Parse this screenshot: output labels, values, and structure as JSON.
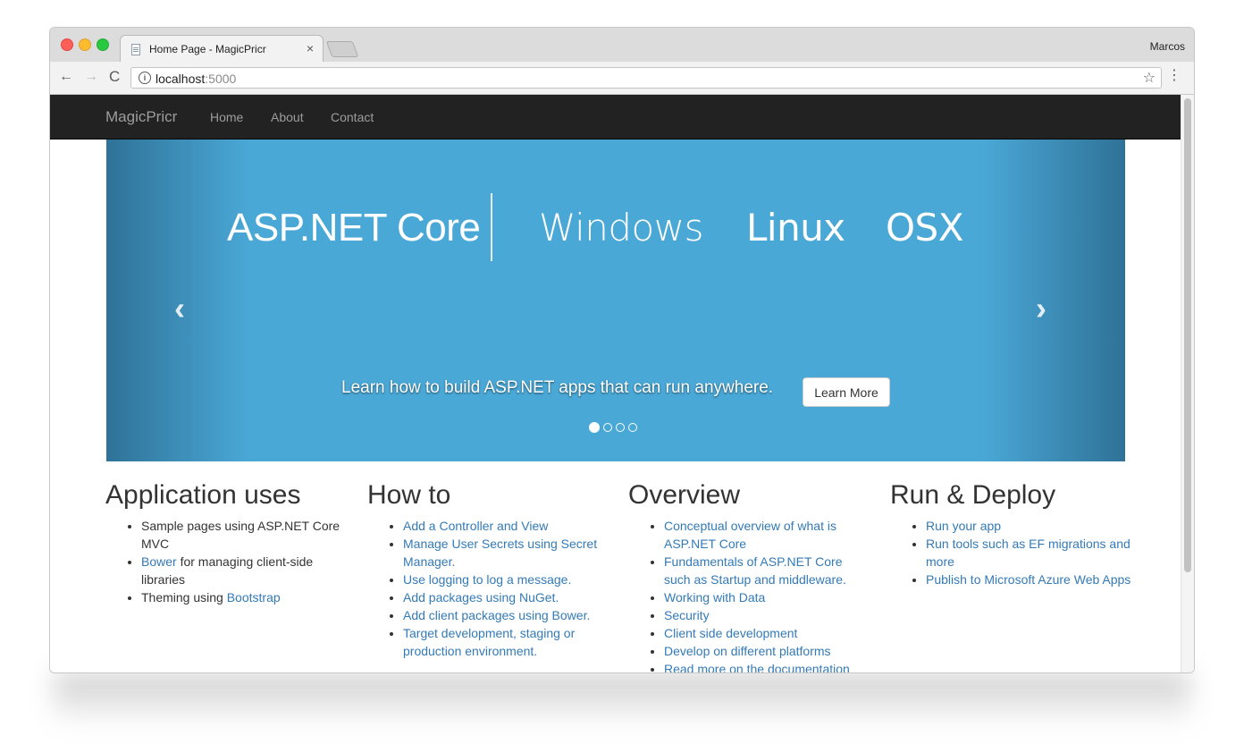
{
  "browser": {
    "tab_title": "Home Page - MagicPricr",
    "tab_close": "×",
    "profile_name": "Marcos",
    "url_host": "localhost",
    "url_port": ":5000",
    "info_glyph": "i",
    "back_glyph": "←",
    "forward_glyph": "→",
    "reload_glyph": "C",
    "star_glyph": "☆",
    "menu_glyph": "⋮",
    "icons": {
      "back": "back-arrow-icon",
      "forward": "forward-arrow-icon",
      "reload": "reload-icon",
      "info": "info-circle-icon",
      "bookmark": "star-icon",
      "menu": "vertical-dots-icon",
      "favicon": "page-icon"
    }
  },
  "navbar": {
    "brand": "MagicPricr",
    "links": [
      "Home",
      "About",
      "Contact"
    ],
    "background": "#222222",
    "link_color": "#9d9d9d"
  },
  "carousel": {
    "words": {
      "aspnet": "ASP.NET Core",
      "windows": "Windows",
      "linux": "Linux",
      "osx": "OSX"
    },
    "prev_glyph": "‹",
    "next_glyph": "›",
    "caption": "Learn how to build ASP.NET apps that can run anywhere.",
    "button_label": "Learn More",
    "slide_count": 4,
    "active_slide": 1,
    "background": "#4aa8d6"
  },
  "columns": [
    {
      "heading": "Application uses",
      "items": [
        {
          "text": "Sample pages using ASP.NET Core MVC"
        },
        {
          "link": "Bower",
          "text": " for managing client-side libraries"
        },
        {
          "text": "Theming using ",
          "link_after": "Bootstrap"
        }
      ]
    },
    {
      "heading": "How to",
      "items": [
        {
          "link": "Add a Controller and View"
        },
        {
          "link": "Manage User Secrets using Secret Manager."
        },
        {
          "link": "Use logging to log a message."
        },
        {
          "link": "Add packages using NuGet."
        },
        {
          "link": "Add client packages using Bower."
        },
        {
          "link": "Target development, staging or production environment."
        }
      ]
    },
    {
      "heading": "Overview",
      "items": [
        {
          "link": "Conceptual overview of what is ASP.NET Core"
        },
        {
          "link": "Fundamentals of ASP.NET Core such as Startup and middleware."
        },
        {
          "link": "Working with Data"
        },
        {
          "link": "Security"
        },
        {
          "link": "Client side development"
        },
        {
          "link": "Develop on different platforms"
        },
        {
          "link": "Read more on the documentation site"
        }
      ]
    },
    {
      "heading": "Run & Deploy",
      "items": [
        {
          "link": "Run your app"
        },
        {
          "link": "Run tools such as EF migrations and more"
        },
        {
          "link": "Publish to Microsoft Azure Web Apps"
        }
      ]
    }
  ],
  "colors": {
    "link": "#337ab7",
    "text": "#333333"
  }
}
